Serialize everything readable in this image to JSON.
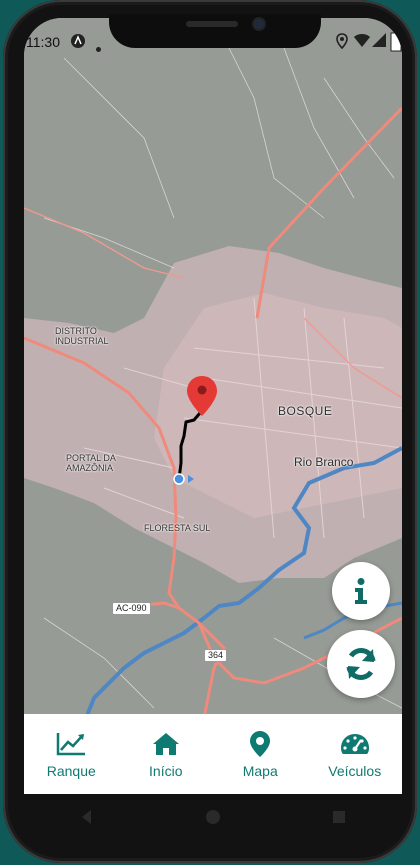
{
  "status_bar": {
    "time": "11:30",
    "icons": [
      "app-notification-icon",
      "dot-icon",
      "location-icon",
      "wifi-icon",
      "signal-icon"
    ]
  },
  "map": {
    "labels": {
      "distrito_industrial": "DISTRITO\nINDUSTRIAL",
      "bosque": "BOSQUE",
      "rio_branco": "Rio Branco",
      "portal_da_amazonia": "PORTAL DA\nAMAZÔNIA",
      "floresta_sul": "FLORESTA SUL"
    },
    "road_shields": {
      "ac090": "AC-090",
      "r364": "364"
    },
    "colors": {
      "land": "#969b95",
      "urban": "#c9b4b6",
      "road": "#ef8a7c",
      "water": "#4f87c4",
      "route": "#000000",
      "pin": "#e53935"
    }
  },
  "fabs": {
    "info": {
      "icon": "info-icon",
      "color": "#0f6b66"
    },
    "refresh": {
      "icon": "refresh-icon",
      "color": "#0f6b66"
    }
  },
  "bottom_nav": {
    "items": [
      {
        "label": "Ranque",
        "icon": "chart-line-icon"
      },
      {
        "label": "Início",
        "icon": "home-icon"
      },
      {
        "label": "Mapa",
        "icon": "map-pin-icon"
      },
      {
        "label": "Veículos",
        "icon": "speedometer-icon"
      }
    ],
    "color": "#0f7a72"
  },
  "system_nav": {
    "buttons": [
      "back-button",
      "home-button",
      "recents-button"
    ]
  }
}
